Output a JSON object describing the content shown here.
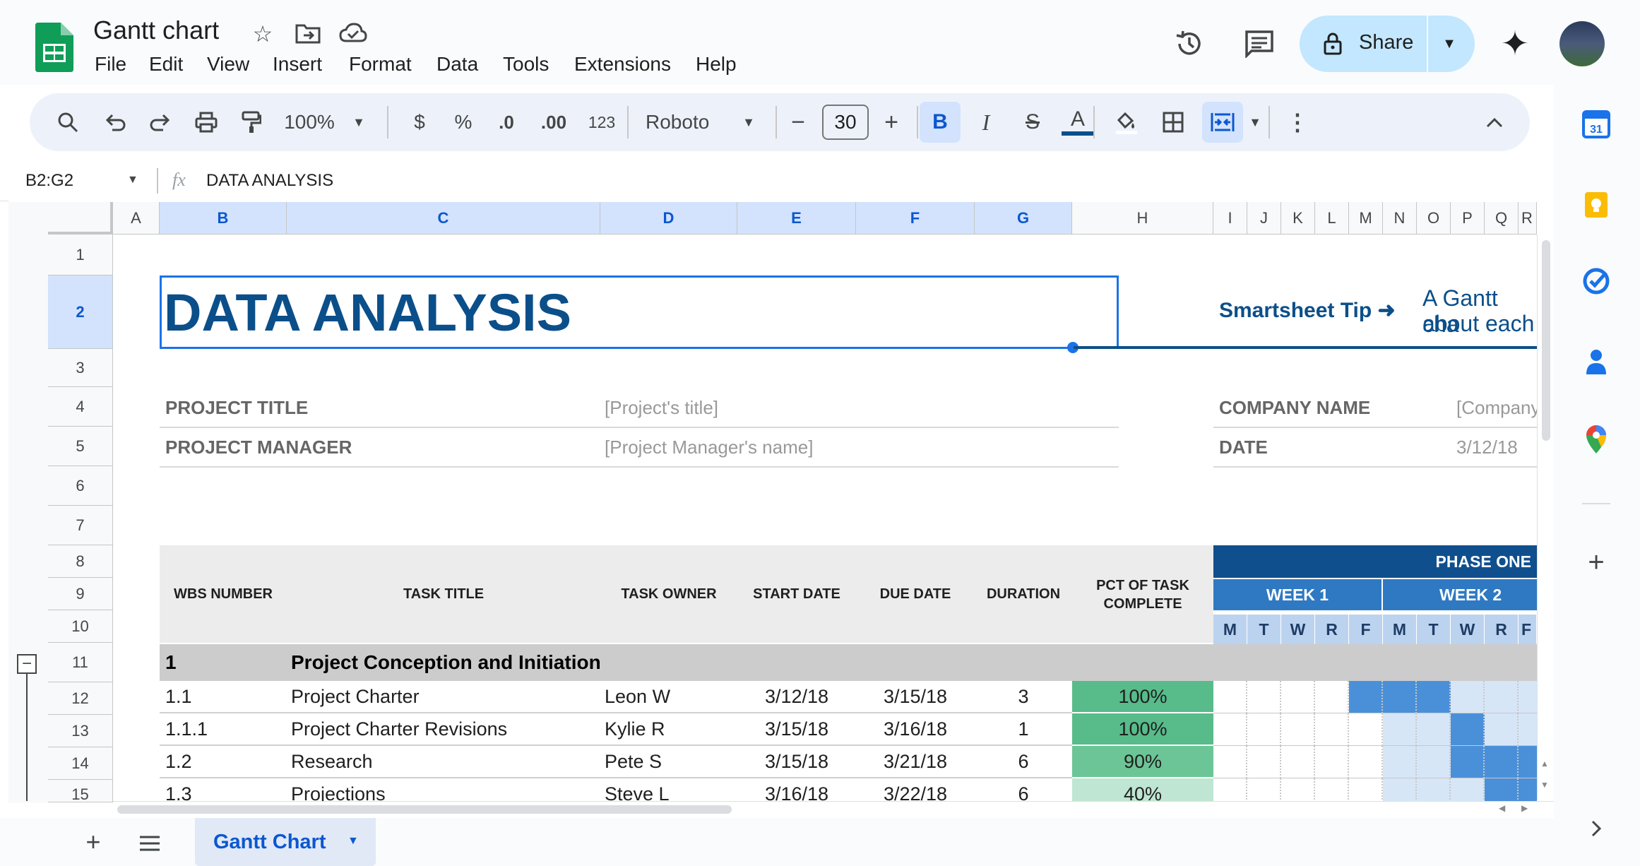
{
  "app": {
    "doc_title": "Gantt chart",
    "menu": [
      "File",
      "Edit",
      "View",
      "Insert",
      "Format",
      "Data",
      "Tools",
      "Extensions",
      "Help"
    ],
    "share_label": "Share"
  },
  "toolbar": {
    "zoom": "100%",
    "currency": "$",
    "percent": "%",
    "dec_decrease": ".0",
    "dec_increase": ".00",
    "number_format": "123",
    "font": "Roboto",
    "font_size": "30",
    "minus": "−",
    "plus": "+",
    "bold": "B",
    "italic": "I",
    "strike": "S",
    "text_color": "A"
  },
  "formula_bar": {
    "cell_ref": "B2:G2",
    "fx": "fx",
    "value": "DATA ANALYSIS"
  },
  "columns": [
    "A",
    "B",
    "C",
    "D",
    "E",
    "F",
    "G",
    "H",
    "I",
    "J",
    "K",
    "L",
    "M",
    "N",
    "O",
    "P",
    "Q",
    "R"
  ],
  "selected_columns": [
    "B",
    "C",
    "D",
    "E",
    "F",
    "G"
  ],
  "rows": [
    "1",
    "2",
    "3",
    "4",
    "5",
    "6",
    "7",
    "8",
    "9",
    "10",
    "11",
    "12",
    "13",
    "14",
    "15"
  ],
  "sheet": {
    "title": "DATA ANALYSIS",
    "tip_label": "Smartsheet Tip ➜",
    "tip_text_1": "A Gantt cha",
    "tip_text_2": "about each",
    "project_title_label": "PROJECT TITLE",
    "project_title_value": "[Project's title]",
    "project_manager_label": "PROJECT MANAGER",
    "project_manager_value": "[Project Manager's name]",
    "company_label": "COMPANY NAME",
    "company_value": "[Company",
    "date_label": "DATE",
    "date_value": "3/12/18"
  },
  "table": {
    "headers": {
      "wbs": "WBS NUMBER",
      "task": "TASK TITLE",
      "owner": "TASK OWNER",
      "start": "START DATE",
      "due": "DUE DATE",
      "duration": "DURATION",
      "pct_1": "PCT OF TASK",
      "pct_2": "COMPLETE"
    },
    "phase": "PHASE ONE",
    "week1": "WEEK 1",
    "week2": "WEEK 2",
    "days": [
      "M",
      "T",
      "W",
      "R",
      "F",
      "M",
      "T",
      "W",
      "R",
      "F"
    ],
    "section": {
      "number": "1",
      "title": "Project Conception and Initiation"
    },
    "tasks": [
      {
        "wbs": "1.1",
        "title": "Project Charter",
        "owner": "Leon W",
        "start": "3/12/18",
        "due": "3/15/18",
        "duration": "3",
        "pct": "100%"
      },
      {
        "wbs": "1.1.1",
        "title": "Project Charter Revisions",
        "owner": "Kylie R",
        "start": "3/15/18",
        "due": "3/16/18",
        "duration": "1",
        "pct": "100%"
      },
      {
        "wbs": "1.2",
        "title": "Research",
        "owner": "Pete S",
        "start": "3/15/18",
        "due": "3/21/18",
        "duration": "6",
        "pct": "90%"
      },
      {
        "wbs": "1.3",
        "title": "Projections",
        "owner": "Steve L",
        "start": "3/16/18",
        "due": "3/22/18",
        "duration": "6",
        "pct": "40%"
      }
    ]
  },
  "tabs": {
    "active": "Gantt Chart"
  },
  "colors": {
    "title_blue": "#0b4f8a",
    "phase_header": "#104f8e",
    "week_header": "#2f79c2",
    "day_header": "#bcd3ef",
    "pct_full": "#57bb8a",
    "bar_dark": "#4a90d9",
    "bar_light": "#d6e6f7",
    "section_bg": "#cccccc",
    "selection": "#1a73e8"
  }
}
